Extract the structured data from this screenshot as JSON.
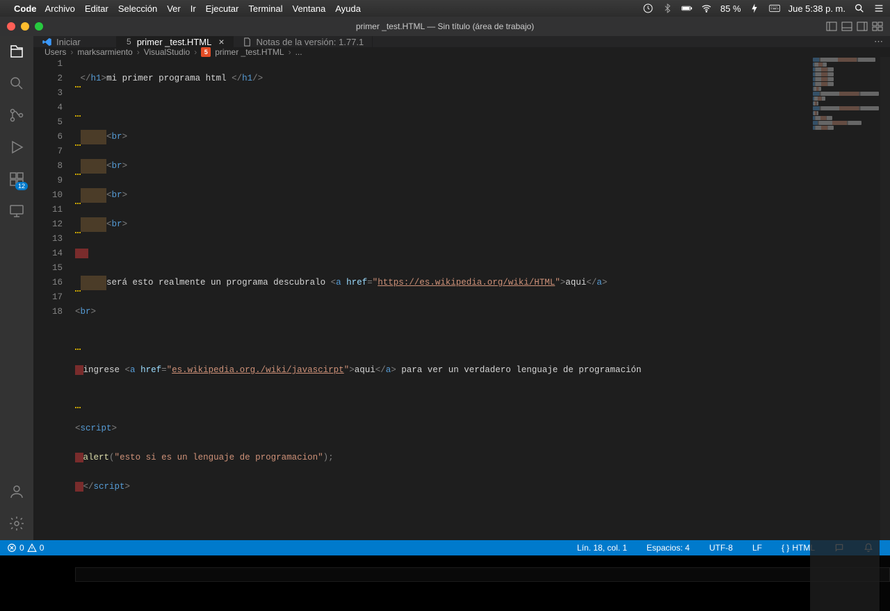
{
  "menubar": {
    "app": "Code",
    "items": [
      "Archivo",
      "Editar",
      "Selección",
      "Ver",
      "Ir",
      "Ejecutar",
      "Terminal",
      "Ventana",
      "Ayuda"
    ],
    "right": {
      "battery": "85 %",
      "clock": "Jue 5:38 p. m."
    }
  },
  "titlebar": {
    "title": "primer _test.HTML — Sin título (área de trabajo)"
  },
  "activitybar": {
    "ext_badge": "12"
  },
  "tabs": {
    "items": [
      {
        "label": "Iniciar",
        "icon": "vscode",
        "active": false
      },
      {
        "label": "primer _test.HTML",
        "icon": "html5",
        "active": true,
        "close": true
      },
      {
        "label": "Notas de la versión: 1.77.1",
        "icon": "doc",
        "active": false
      }
    ]
  },
  "breadcrumbs": {
    "parts": [
      "Users",
      "marksarmiento",
      "VisualStudio"
    ],
    "file": "primer _test.HTML",
    "tail": "..."
  },
  "editor": {
    "lines": [
      1,
      2,
      3,
      4,
      5,
      6,
      7,
      8,
      9,
      10,
      11,
      12,
      13,
      14,
      15,
      16,
      17,
      18
    ],
    "code": {
      "l1": {
        "open_tag_pre": "</",
        "open_tag_name": "h1",
        "open_tag_post": ">",
        "text": "mi primer programa html ",
        "close_tag_pre": "</",
        "close_tag_name": "h1",
        "close_tag_slash": "/",
        "close_tag_post": ">"
      },
      "l3": {
        "indent_pre": "     ",
        "tag_pre": "<",
        "tag_name": "br",
        "tag_post": ">"
      },
      "l4": {
        "indent_pre": "     ",
        "tag_pre": "<",
        "tag_name": "br",
        "tag_post": ">"
      },
      "l5": {
        "indent_pre": "     ",
        "tag_pre": "<",
        "tag_name": "br",
        "tag_post": ">"
      },
      "l6": {
        "indent_pre": "     ",
        "tag_pre": "<",
        "tag_name": "br",
        "tag_post": ">"
      },
      "l8": {
        "indent_pre": "     ",
        "text1": "será esto realmente un programa descubralo ",
        "a_open_pre": "<",
        "a_name": "a",
        "sp": " ",
        "attr": "href",
        "eq": "=",
        "q": "\"",
        "href": "https://es.wikipedia.org/wiki/HTML",
        "a_open_post": ">",
        "link_text": "aqui",
        "a_close_pre": "</",
        "a_close_name": "a",
        "a_close_post": ">"
      },
      "l9": {
        "tag_pre": "<",
        "tag_name": "br",
        "tag_post": ">"
      },
      "l11": {
        "text1": "ingrese ",
        "a_open_pre": "<",
        "a_name": "a",
        "sp": " ",
        "attr": "href",
        "eq": "=",
        "q": "\"",
        "href": "es.wikipedia.org./wiki/javascirpt",
        "a_open_post": ">",
        "link_text": "aqui",
        "a_close_pre": "</",
        "a_close_name": "a",
        "a_close_post": ">",
        "text2": " para ver un verdadero lenguaje de programación"
      },
      "l13": {
        "tag_pre": "<",
        "tag_name": "script",
        "tag_post": ">"
      },
      "l14": {
        "func": "alert",
        "paren_o": "(",
        "q": "\"",
        "str": "esto si es un lenguaje de programacion",
        "paren_c": ")",
        "semi": ";"
      },
      "l15": {
        "tag_pre": "</",
        "tag_name": "script",
        "tag_post": ">"
      }
    }
  },
  "statusbar": {
    "errors": "0",
    "warnings": "0",
    "cursor": "Lín. 18, col. 1",
    "spaces": "Espacios: 4",
    "encoding": "UTF-8",
    "eol": "LF",
    "lang": "HTML"
  }
}
